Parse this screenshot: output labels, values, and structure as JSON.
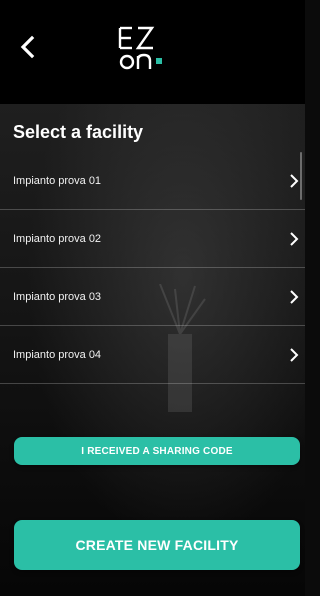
{
  "header": {
    "back_icon": "chevron-left-icon",
    "logo": {
      "line1": "EZ",
      "line2": "on",
      "accent_color": "#2bbfa6"
    }
  },
  "page": {
    "title": "Select a facility"
  },
  "facilities": [
    {
      "label": "Impianto prova 01"
    },
    {
      "label": "Impianto prova 02"
    },
    {
      "label": "Impianto prova 03"
    },
    {
      "label": "Impianto prova 04"
    }
  ],
  "actions": {
    "sharing_code_label": "I RECEIVED A SHARING CODE",
    "create_facility_label": "CREATE NEW FACILITY"
  },
  "colors": {
    "accent": "#2bbfa6",
    "background": "#000000",
    "text": "#ffffff"
  }
}
